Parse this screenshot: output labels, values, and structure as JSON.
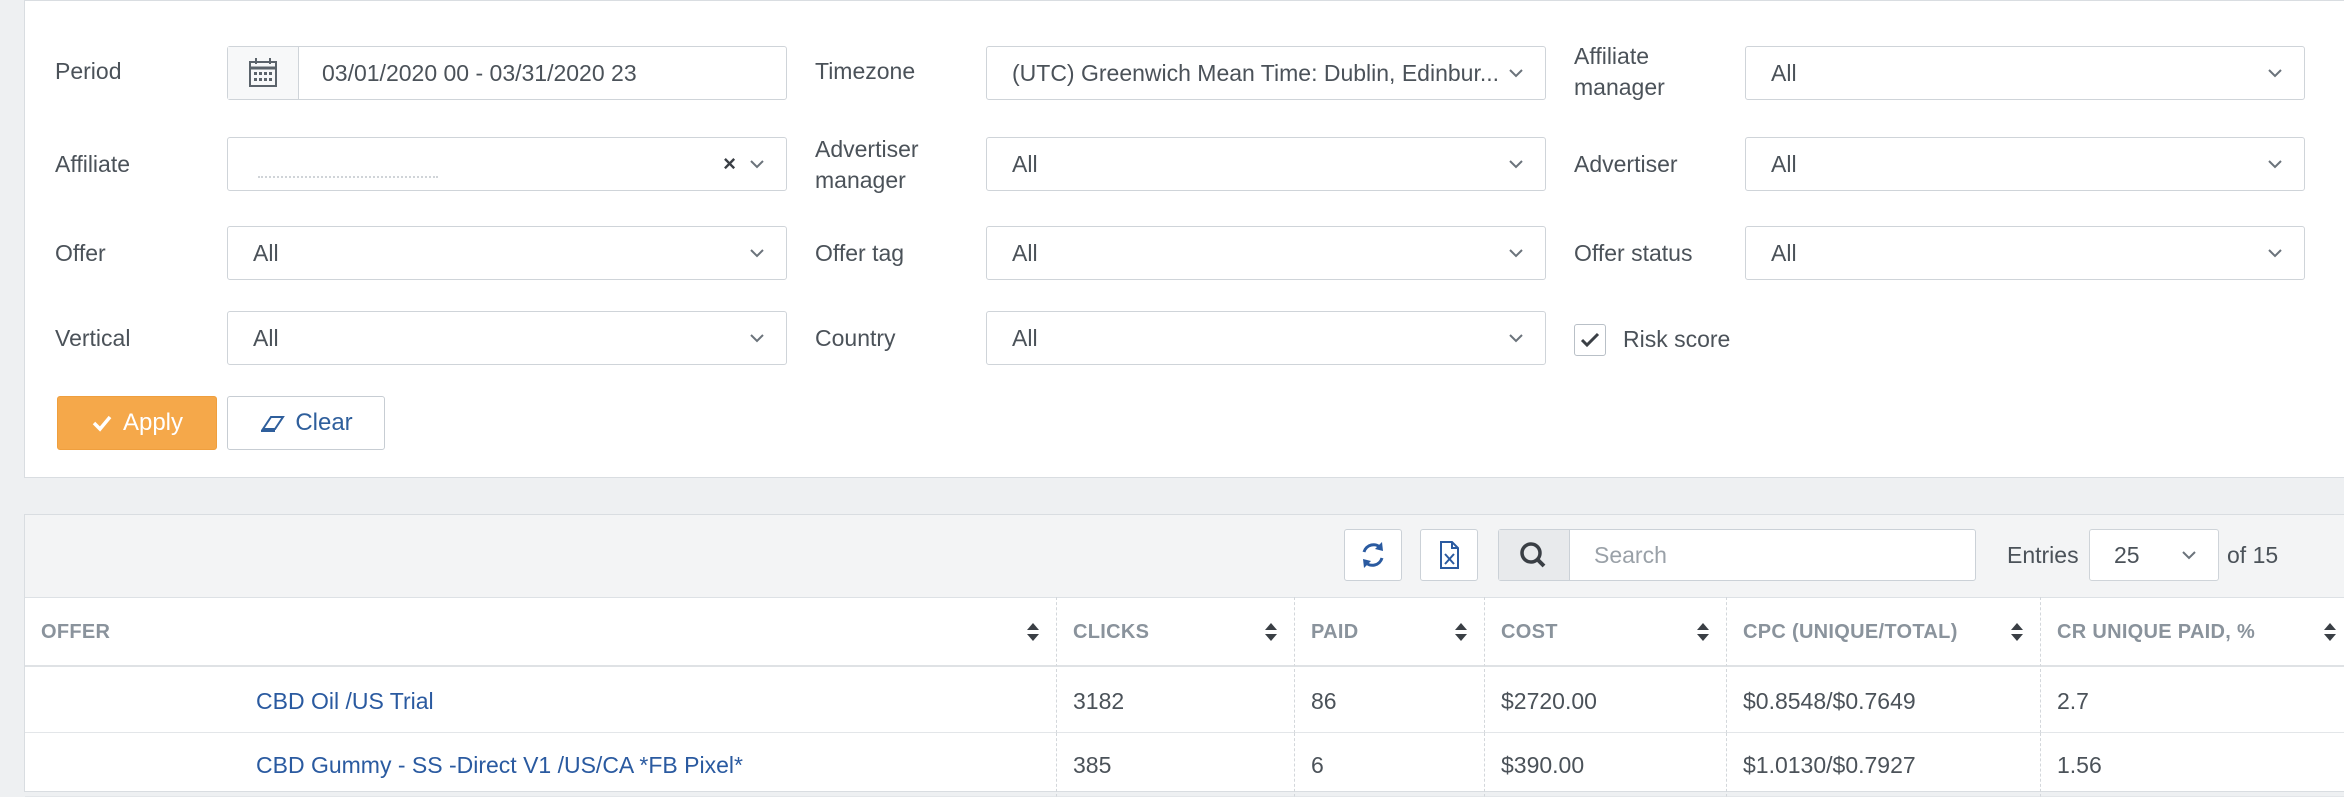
{
  "filters": {
    "period_label": "Period",
    "period_value": "03/01/2020 00 - 03/31/2020 23",
    "timezone_label": "Timezone",
    "timezone_value": "(UTC) Greenwich Mean Time: Dublin, Edinbur...",
    "affiliate_manager_label_1": "Affiliate",
    "affiliate_manager_label_2": "manager",
    "affiliate_manager_value": "All",
    "affiliate_label": "Affiliate",
    "affiliate_value": "",
    "affiliate_clear_glyph": "×",
    "advertiser_manager_label_1": "Advertiser",
    "advertiser_manager_label_2": "manager",
    "advertiser_manager_value": "All",
    "advertiser_label": "Advertiser",
    "advertiser_value": "All",
    "offer_label": "Offer",
    "offer_value": "All",
    "offer_tag_label": "Offer tag",
    "offer_tag_value": "All",
    "offer_status_label": "Offer status",
    "offer_status_value": "All",
    "vertical_label": "Vertical",
    "vertical_value": "All",
    "country_label": "Country",
    "country_value": "All",
    "risk_score_label": "Risk score",
    "risk_score_checked": true,
    "apply_label": "Apply",
    "clear_label": "Clear"
  },
  "table": {
    "search_placeholder": "Search",
    "entries_label": "Entries",
    "entries_value": "25",
    "of_label": "of 15",
    "columns": [
      "OFFER",
      "CLICKS",
      "PAID",
      "COST",
      "CPC (UNIQUE/TOTAL)",
      "CR UNIQUE PAID, %"
    ],
    "rows": [
      {
        "offer": "CBD Oil /US Trial",
        "clicks": "3182",
        "paid": "86",
        "cost": "$2720.00",
        "cpc": "$0.8548/$0.7649",
        "cr": "2.7"
      },
      {
        "offer": "CBD Gummy - SS -Direct V1 /US/CA *FB Pixel*",
        "clicks": "385",
        "paid": "6",
        "cost": "$390.00",
        "cpc": "$1.0130/$0.7927",
        "cr": "1.56"
      }
    ]
  },
  "colors": {
    "accent": "#f5a84a",
    "link": "#2a5aa0"
  },
  "icons": [
    "calendar-icon",
    "chevron-down-icon",
    "clear-x-icon",
    "check-icon",
    "eraser-icon",
    "refresh-icon",
    "excel-icon",
    "search-icon",
    "sort-icon"
  ]
}
